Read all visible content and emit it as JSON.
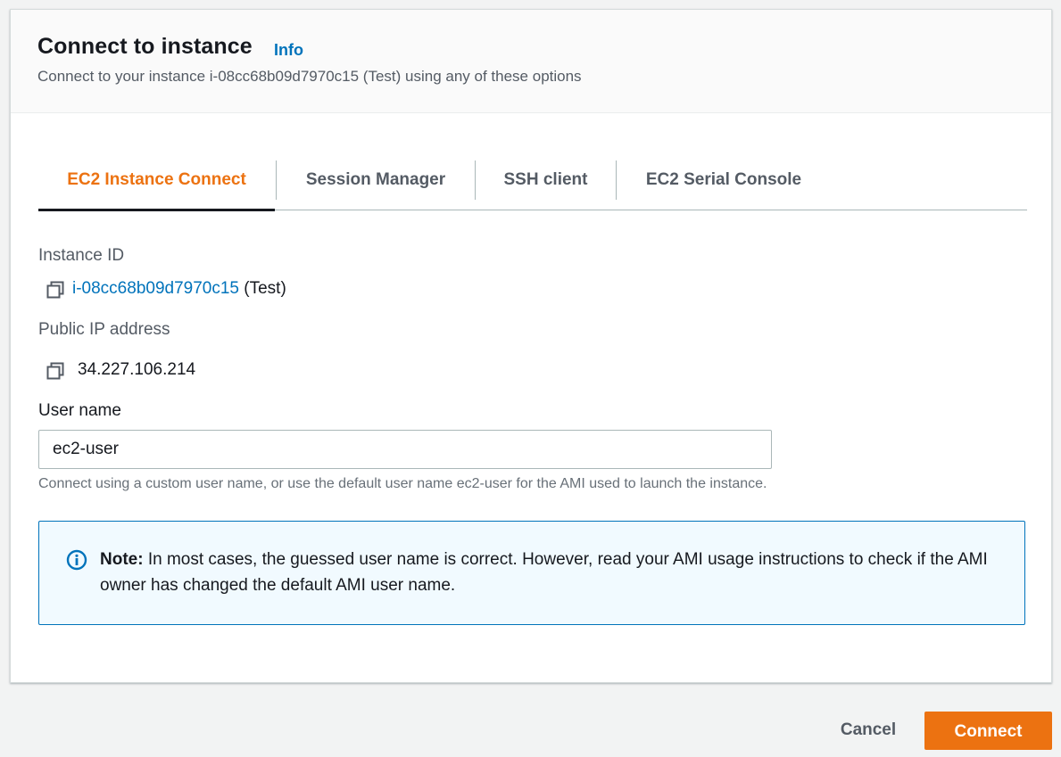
{
  "header": {
    "title": "Connect to instance",
    "info_link": "Info",
    "subtitle": "Connect to your instance i-08cc68b09d7970c15 (Test) using any of these options"
  },
  "tabs": [
    {
      "label": "EC2 Instance Connect",
      "active": true
    },
    {
      "label": "Session Manager",
      "active": false
    },
    {
      "label": "SSH client",
      "active": false
    },
    {
      "label": "EC2 Serial Console",
      "active": false
    }
  ],
  "instance_id": {
    "label": "Instance ID",
    "value": "i-08cc68b09d7970c15",
    "suffix": "(Test)",
    "icon": "copy-icon"
  },
  "public_ip": {
    "label": "Public IP address",
    "value": "34.227.106.214",
    "icon": "copy-icon"
  },
  "user_name": {
    "label": "User name",
    "value": "ec2-user",
    "hint": "Connect using a custom user name, or use the default user name ec2-user for the AMI used to launch the instance."
  },
  "note": {
    "icon": "info-circle-icon",
    "strong": "Note:",
    "text": " In most cases, the guessed user name is correct. However, read your AMI usage instructions to check if the AMI owner has changed the default AMI user name."
  },
  "footer": {
    "cancel_label": "Cancel",
    "connect_label": "Connect"
  },
  "colors": {
    "accent": "#ec7211",
    "link": "#0073bb",
    "info_bg": "#f1faff"
  }
}
